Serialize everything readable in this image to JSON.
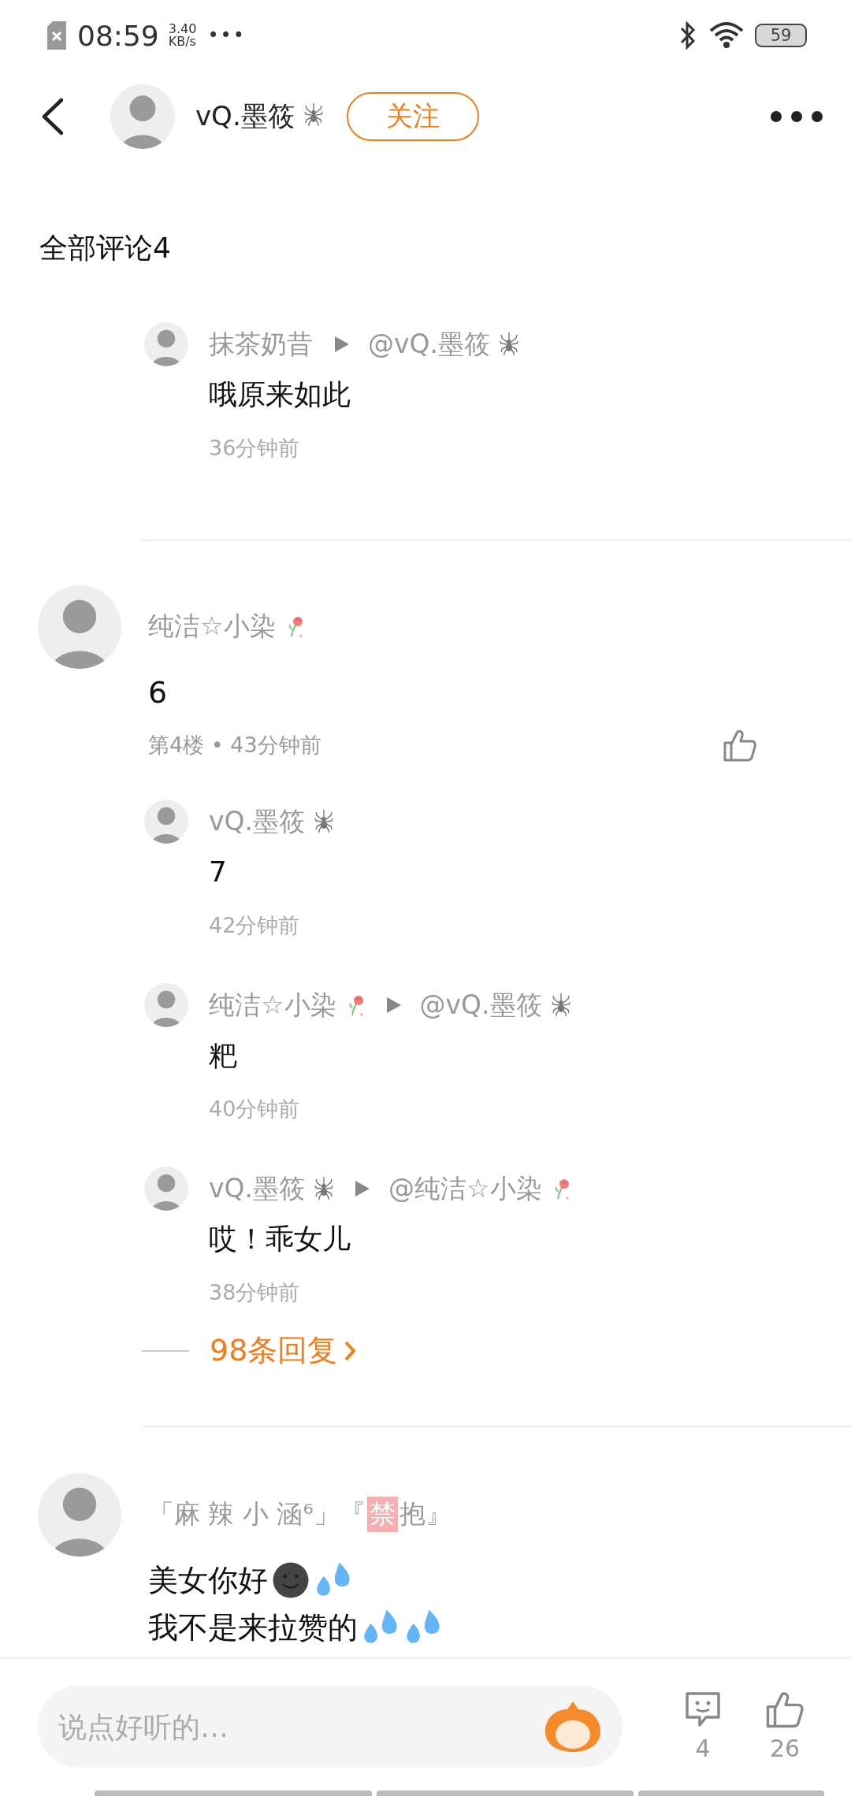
{
  "status_bar": {
    "time": "08:59",
    "speed": "3.40",
    "speed_unit": "KB/s",
    "more": "•••",
    "battery": "59"
  },
  "header": {
    "author": {
      "name": "vQ.墨筱",
      "badge": {
        "kind": "spider"
      }
    },
    "follow": "关注"
  },
  "section_title": "全部评论4",
  "threads": [
    {
      "replies": [
        {
          "author": {
            "name": "抹茶奶昔"
          },
          "reply_to": {
            "name": "@vQ.墨筱",
            "badge": {
              "kind": "spider"
            }
          },
          "lines": [
            {
              "text": "哦原来如此"
            }
          ],
          "time": "36分钟前"
        }
      ]
    },
    {
      "comment": {
        "author": {
          "name": "纯洁☆小染",
          "badge": {
            "kind": "rose"
          }
        },
        "lines": [
          {
            "text": "6"
          }
        ],
        "meta": "第4楼 • 43分钟前"
      },
      "replies": [
        {
          "author": {
            "name": "vQ.墨筱",
            "badge": {
              "kind": "spider"
            }
          },
          "lines": [
            {
              "text": "7"
            }
          ],
          "time": "42分钟前"
        },
        {
          "author": {
            "name": "纯洁☆小染",
            "badge": {
              "kind": "rose"
            }
          },
          "reply_to": {
            "name": "@vQ.墨筱",
            "badge": {
              "kind": "spider"
            }
          },
          "lines": [
            {
              "text": "粑"
            }
          ],
          "time": "40分钟前"
        },
        {
          "author": {
            "name": "vQ.墨筱",
            "badge": {
              "kind": "spider"
            }
          },
          "reply_to": {
            "name": "@纯洁☆小染",
            "badge": {
              "kind": "rose"
            }
          },
          "lines": [
            {
              "text": "哎！乖女儿"
            }
          ],
          "time": "38分钟前"
        }
      ],
      "more": "98条回复"
    },
    {
      "comment": {
        "author": {
          "name": "「麻 辣 小 涵⁶」『",
          "tag": "禁",
          "name_end": "抱』"
        },
        "lines": [
          {
            "text": "美女你好",
            "emojis": [
              {
                "kind": "smile"
              },
              {
                "kind": "sweat"
              }
            ]
          },
          {
            "text": "我不是来拉赞的",
            "emojis": [
              {
                "kind": "sweat"
              },
              {
                "kind": "sweat"
              }
            ]
          }
        ]
      }
    }
  ],
  "bottom_bar": {
    "placeholder": "说点好听的…",
    "comment_count": "4",
    "like_count": "26"
  }
}
